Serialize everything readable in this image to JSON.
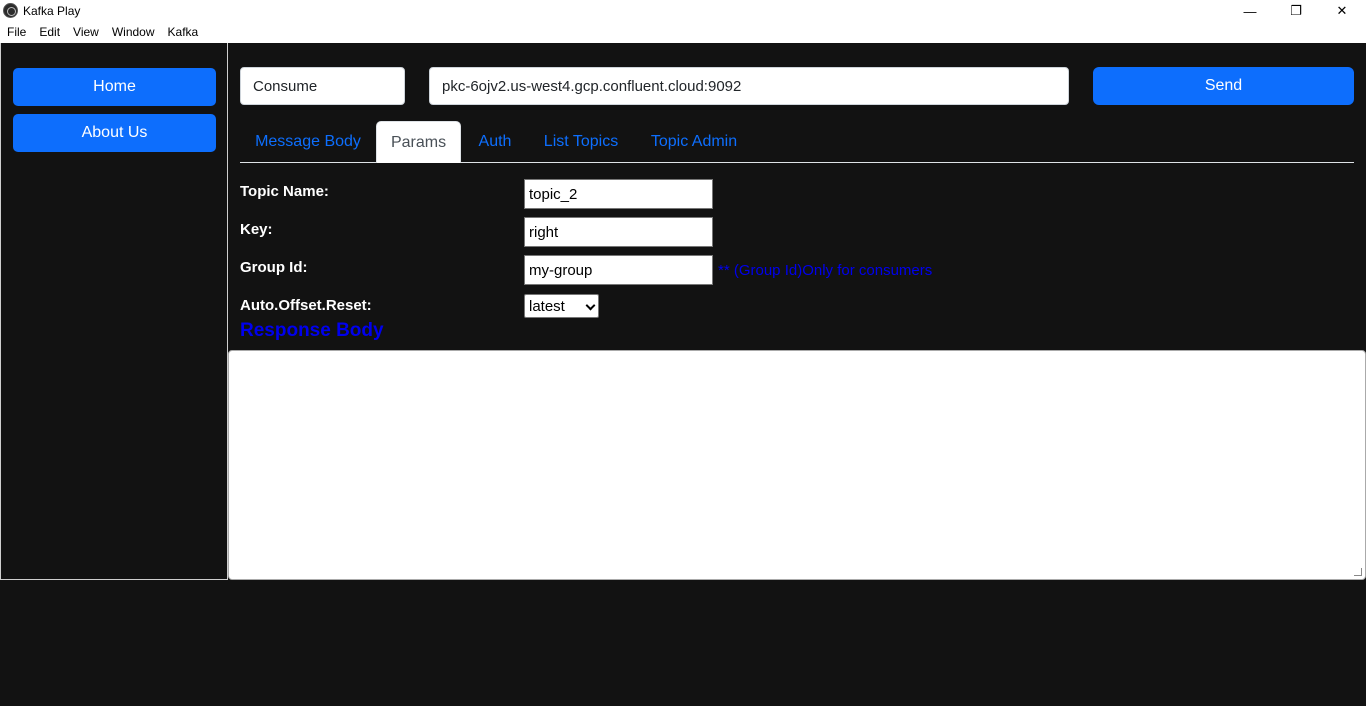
{
  "window": {
    "title": "Kafka Play",
    "minimize": "—",
    "restore": "❐",
    "close": "✕"
  },
  "menu": [
    "File",
    "Edit",
    "View",
    "Window",
    "Kafka"
  ],
  "sidebar": {
    "items": [
      {
        "label": "Home"
      },
      {
        "label": "About Us"
      }
    ]
  },
  "request": {
    "mode": "Consume",
    "url": "pkc-6ojv2.us-west4.gcp.confluent.cloud:9092",
    "send_label": "Send"
  },
  "tabs": [
    {
      "label": "Message Body",
      "active": false
    },
    {
      "label": "Params",
      "active": true
    },
    {
      "label": "Auth",
      "active": false
    },
    {
      "label": "List Topics",
      "active": false
    },
    {
      "label": "Topic Admin",
      "active": false
    }
  ],
  "params": {
    "topic_label": "Topic Name:",
    "topic_value": "topic_2",
    "key_label": "Key:",
    "key_value": "right",
    "group_label": "Group Id:",
    "group_value": "my-group",
    "group_hint": "** (Group Id)Only for consumers",
    "offset_label": "Auto.Offset.Reset:",
    "offset_value": "latest"
  },
  "response": {
    "title": "Response Body",
    "body": ""
  },
  "colors": {
    "accent": "#0d6efd",
    "background": "#121212",
    "link": "#0000ee"
  }
}
